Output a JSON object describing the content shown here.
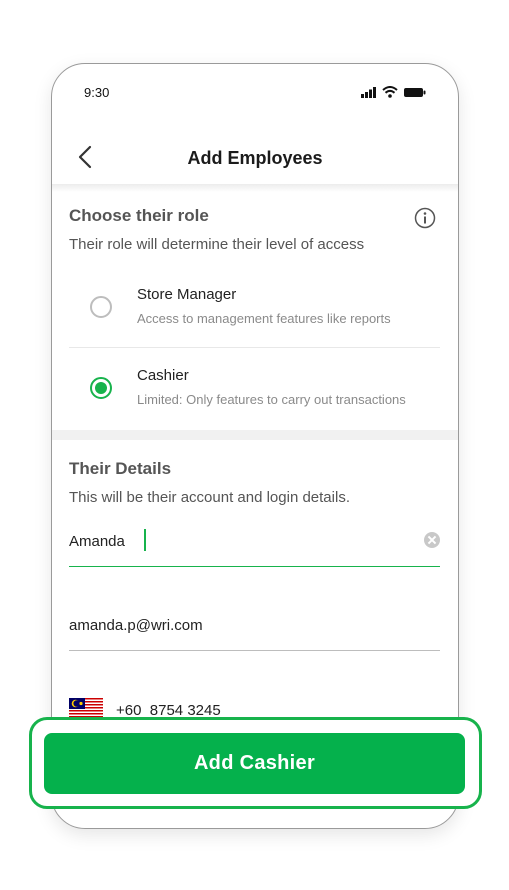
{
  "status_bar": {
    "time": "9:30"
  },
  "header": {
    "title": "Add Employees"
  },
  "role_section": {
    "title": "Choose their role",
    "subtitle": "Their role will determine their level of access",
    "options": [
      {
        "label": "Store Manager",
        "description": "Access to management features like reports",
        "selected": false
      },
      {
        "label": "Cashier",
        "description": "Limited: Only features to carry out transactions",
        "selected": true
      }
    ]
  },
  "details_section": {
    "title": "Their Details",
    "subtitle": "This will be their account and login details.",
    "name_value": "Amanda",
    "email_value": "amanda.p@wri.com",
    "phone_value": "+60  8754 3245"
  },
  "cta": {
    "label": "Add Cashier"
  },
  "colors": {
    "accent": "#05b14c",
    "radio_selected": "#17b34c"
  },
  "icons": [
    "signal-icon",
    "wifi-icon",
    "battery-icon",
    "back-chevron-icon",
    "info-icon",
    "clear-icon",
    "malaysia-flag-icon"
  ]
}
